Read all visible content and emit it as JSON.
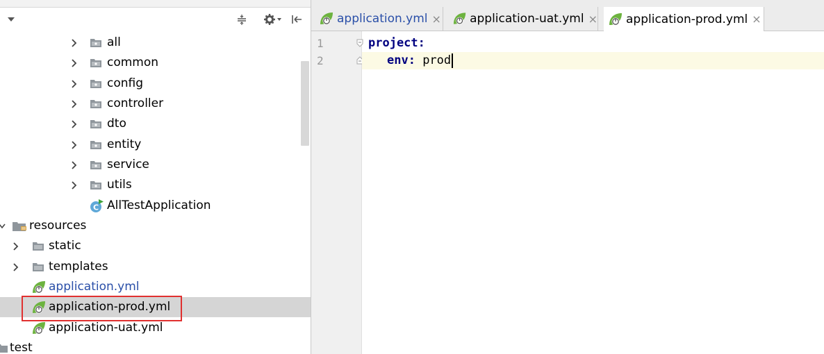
{
  "project_tree": {
    "packages": [
      {
        "label": "all"
      },
      {
        "label": "common"
      },
      {
        "label": "config"
      },
      {
        "label": "controller"
      },
      {
        "label": "dto"
      },
      {
        "label": "entity"
      },
      {
        "label": "service"
      },
      {
        "label": "utils"
      }
    ],
    "main_class": "AllTestApplication",
    "resources": {
      "label": "resources",
      "folders": [
        "static",
        "templates"
      ],
      "files": [
        {
          "label": "application.yml",
          "selected": false
        },
        {
          "label": "application-prod.yml",
          "selected": true
        },
        {
          "label": "application-uat.yml",
          "selected": false
        }
      ]
    },
    "test_label": "test"
  },
  "editor": {
    "tabs": [
      {
        "label": "application.yml",
        "active": false
      },
      {
        "label": "application-uat.yml",
        "active": false
      },
      {
        "label": "application-prod.yml",
        "active": true
      }
    ],
    "close_glyph": "×",
    "lines": [
      {
        "number": "1",
        "key": "project:",
        "value": ""
      },
      {
        "number": "2",
        "key": "env:",
        "value": " prod"
      }
    ]
  },
  "colors": {
    "selection_bg": "#d5d5d5",
    "highlight_border": "#e0302f",
    "yaml_key": "#000080",
    "current_line": "#fcfae4",
    "spring_green": "#6db33f"
  },
  "icons": {
    "toolbar": [
      "collapse-all-icon",
      "gear-icon",
      "hide-panel-icon"
    ],
    "tree": [
      "package-folder-icon",
      "spring-boot-app-icon",
      "resources-folder-icon",
      "spring-yml-icon"
    ]
  }
}
